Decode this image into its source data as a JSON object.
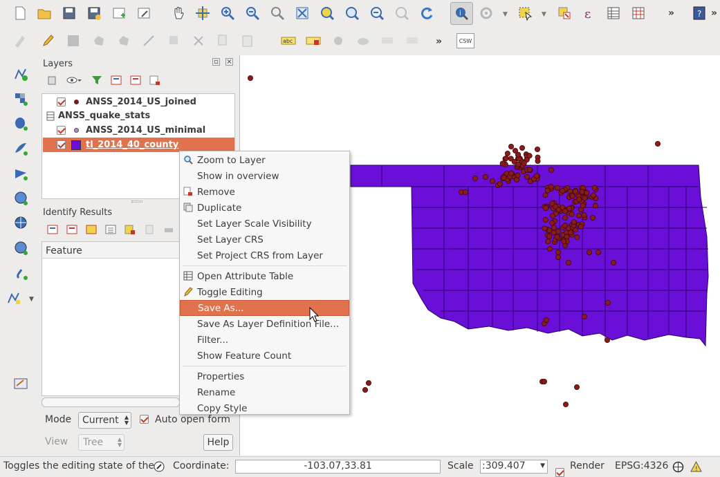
{
  "layers_panel": {
    "title": "Layers",
    "layers": [
      {
        "name": "ANSS_2014_US_joined",
        "checked": true,
        "symbol": "point-dark-red"
      },
      {
        "name": "ANSS_quake_stats",
        "checked": false,
        "symbol": "table"
      },
      {
        "name": "ANSS_2014_US_minimal",
        "checked": true,
        "symbol": "point-light-purple"
      },
      {
        "name": "tl_2014_40_county",
        "checked": true,
        "symbol": "fill-purple"
      }
    ]
  },
  "identify_panel": {
    "title": "Identify Results",
    "feature_header": "Feature",
    "mode_label": "Mode",
    "mode_value": "Current",
    "auto_open_label": "Auto open form",
    "view_label": "View",
    "view_value": "Tree",
    "help_label": "Help"
  },
  "context_menu": {
    "items": [
      {
        "label": "Zoom to Layer",
        "icon": "zoom-icon"
      },
      {
        "label": "Show in overview",
        "icon": ""
      },
      {
        "label": "Remove",
        "icon": "remove-icon"
      },
      {
        "label": "Duplicate",
        "icon": "duplicate-icon"
      },
      {
        "label": "Set Layer Scale Visibility",
        "icon": ""
      },
      {
        "label": "Set Layer CRS",
        "icon": ""
      },
      {
        "label": "Set Project CRS from Layer",
        "icon": ""
      },
      {
        "label": "Open Attribute Table",
        "icon": "table-icon"
      },
      {
        "label": "Toggle Editing",
        "icon": "pencil-icon"
      },
      {
        "label": "Save As...",
        "icon": "",
        "selected": true
      },
      {
        "label": "Save As Layer Definition File...",
        "icon": ""
      },
      {
        "label": "Filter...",
        "icon": ""
      },
      {
        "label": "Show Feature Count",
        "icon": ""
      },
      {
        "label": "Properties",
        "icon": ""
      },
      {
        "label": "Rename",
        "icon": ""
      },
      {
        "label": "Copy Style",
        "icon": ""
      }
    ]
  },
  "toolbar2": {
    "csw_label": "CSW"
  },
  "status_bar": {
    "message": "Toggles the editing state of the",
    "coordinate_label": "Coordinate:",
    "coordinate_value": "-103.07,33.81",
    "scale_label": "Scale",
    "scale_value": ":309.407",
    "render_label": "Render",
    "crs_label": "EPSG:4326"
  },
  "colors": {
    "county_fill": "#6a0fd8",
    "quake_point": "#8b1a1a",
    "selection": "#e0724e"
  }
}
